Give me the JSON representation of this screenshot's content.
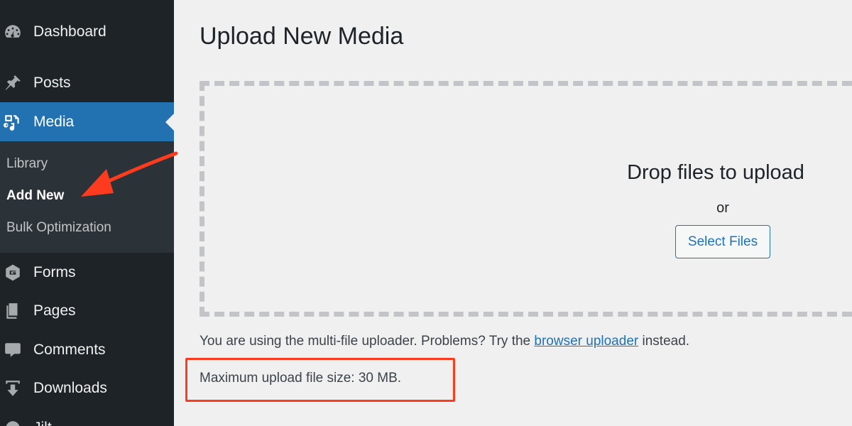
{
  "sidebar": {
    "items": [
      {
        "label": "Dashboard",
        "icon": "dashboard-icon"
      },
      {
        "label": "Posts",
        "icon": "pushpin-icon"
      },
      {
        "label": "Media",
        "icon": "media-icon",
        "current": true
      },
      {
        "label": "Forms",
        "icon": "forms-icon"
      },
      {
        "label": "Pages",
        "icon": "pages-icon"
      },
      {
        "label": "Comments",
        "icon": "comments-icon"
      },
      {
        "label": "Downloads",
        "icon": "downloads-icon"
      },
      {
        "label": "Jilt",
        "icon": "jilt-icon"
      }
    ],
    "submenu": [
      {
        "label": "Library"
      },
      {
        "label": "Add New",
        "active": true
      },
      {
        "label": "Bulk Optimization"
      }
    ]
  },
  "main": {
    "title": "Upload New Media",
    "dropzone": {
      "title": "Drop files to upload",
      "or": "or",
      "select_button": "Select Files"
    },
    "uploader_note": {
      "before": "You are using the multi-file uploader. Problems? Try the ",
      "link": "browser uploader",
      "after": " instead."
    },
    "max_size": "Maximum upload file size: 30 MB."
  },
  "colors": {
    "sidebar_bg": "#1d2327",
    "submenu_bg": "#2c3338",
    "accent": "#2271b1",
    "page_bg": "#f0f0f1",
    "annotation": "#ff3b1f"
  }
}
